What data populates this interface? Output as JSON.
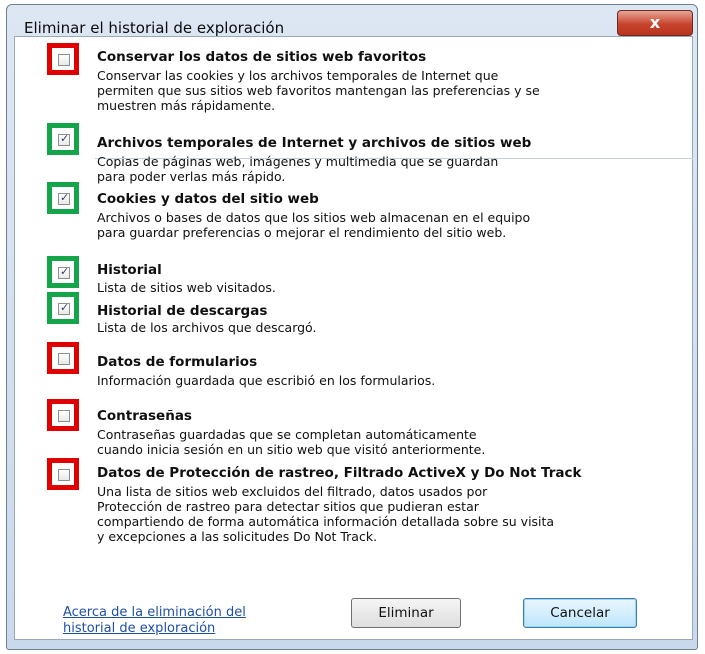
{
  "window": {
    "title": "Eliminar el historial de exploración",
    "close_label": "x"
  },
  "options": [
    {
      "label": "Conservar los datos de sitios web favoritos",
      "checked": false,
      "description_lines": [
        "Conservar las cookies y los archivos temporales de Internet que",
        "permiten que sus sitios web favoritos mantengan las preferencias y se",
        "muestren más rápidamente."
      ]
    },
    {
      "label": "Archivos temporales de Internet y archivos de sitios web",
      "checked": true,
      "description_lines": [
        "Copias de páginas web, imágenes y multimedia que se guardan",
        "para poder verlas más rápido."
      ]
    },
    {
      "label": "Cookies y datos del sitio web",
      "checked": true,
      "description_lines": [
        "Archivos o bases de datos que los sitios web almacenan en el equipo",
        "para guardar preferencias o mejorar el rendimiento del sitio web."
      ]
    },
    {
      "label": "Historial",
      "checked": true,
      "description_lines": [
        "Lista de sitios web visitados."
      ]
    },
    {
      "label": "Historial de descargas",
      "checked": true,
      "description_lines": [
        "Lista de los archivos que descargó."
      ]
    },
    {
      "label": "Datos de formularios",
      "checked": false,
      "description_lines": [
        "Información guardada que escribió en los formularios."
      ]
    },
    {
      "label": "Contraseñas",
      "checked": false,
      "description_lines": [
        "Contraseñas guardadas que se completan automáticamente",
        "cuando inicia sesión en un sitio web que visitó anteriormente."
      ]
    },
    {
      "label": "Datos de Protección de rastreo, Filtrado ActiveX y Do Not Track",
      "checked": false,
      "description_lines": [
        "Una lista de sitios web excluidos del filtrado, datos usados por",
        "Protección de rastreo para detectar sitios que pudieran estar",
        "compartiendo de forma automática información detallada sobre su visita",
        "y excepciones a las solicitudes Do Not Track."
      ]
    }
  ],
  "footer": {
    "link_lines": [
      "Acerca de la eliminación del",
      "historial de exploración"
    ],
    "delete_label": "Eliminar",
    "cancel_label": "Cancelar"
  },
  "colors": {
    "unchecked_highlight": "#e10000",
    "checked_highlight": "#14a54a"
  }
}
